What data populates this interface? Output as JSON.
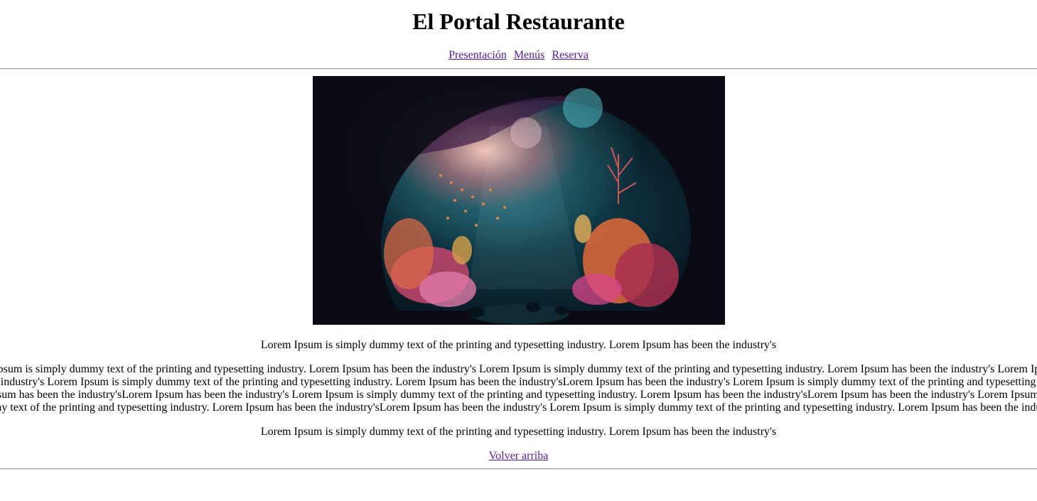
{
  "header": {
    "title": "El Portal Restaurante"
  },
  "nav": {
    "items": [
      {
        "label": "Presentación"
      },
      {
        "label": "Menús"
      },
      {
        "label": "Reserva"
      }
    ]
  },
  "hero": {
    "alt": "underwater coral cave illustration"
  },
  "content": {
    "paragraph_1": "Lorem Ipsum is simply dummy text of the printing and typesetting industry. Lorem Ipsum has been the industry's",
    "paragraph_2": "Lorem Ipsum is simply dummy text of the printing and typesetting industry. Lorem Ipsum has been the industry's Lorem Ipsum is simply dummy text of the printing and typesetting industry. Lorem Ipsum has been the industry's Lorem Ipsum has been the industry's Lorem Ipsum is simply dummy text of the printing and typesetting industry. Lorem Ipsum has been the industry'sLorem Ipsum has been the industry's Lorem Ipsum is simply dummy text of the printing and typesetting industry. Lorem Ipsum has been the industry'sLorem Ipsum has been the industry's Lorem Ipsum is simply dummy text of the printing and typesetting industry. Lorem Ipsum has been the industry'sLorem Ipsum has been the industry's Lorem Ipsum is simply dummy text of the printing and typesetting industry. Lorem Ipsum has been the industry'sLorem Ipsum has been the industry's Lorem Ipsum is simply dummy text of the printing and typesetting industry. Lorem Ipsum has been the industry's",
    "paragraph_3": "Lorem Ipsum is simply dummy text of the printing and typesetting industry. Lorem Ipsum has been the industry's"
  },
  "footer": {
    "back_to_top": "Volver arriba"
  }
}
